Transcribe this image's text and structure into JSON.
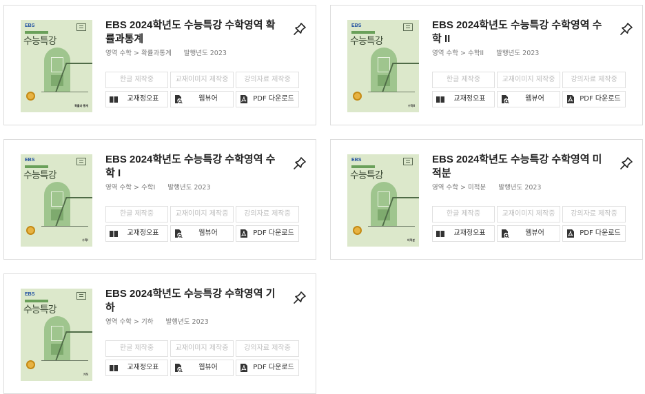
{
  "books": [
    {
      "title": "EBS 2024학년도 수능특강 수학영역 확률과통계",
      "field_label": "영역",
      "field_value": "수학 > 확률과통계",
      "year_label": "발행년도",
      "year_value": "2023",
      "cover": {
        "brand": "EBS",
        "title": "수능특강",
        "subject": "확률과 통계"
      },
      "buttons": {
        "hangul": "한글 제작중",
        "images": "교재이미지 제작중",
        "lecture": "강의자료 제작중",
        "errata": "교재정오표",
        "viewer": "웹뷰어",
        "pdf": "PDF 다운로드"
      }
    },
    {
      "title": "EBS 2024학년도 수능특강 수학영역 수학 II",
      "field_label": "영역",
      "field_value": "수학 > 수학II",
      "year_label": "발행년도",
      "year_value": "2023",
      "cover": {
        "brand": "EBS",
        "title": "수능특강",
        "subject": "수학Ⅱ"
      },
      "buttons": {
        "hangul": "한글 제작중",
        "images": "교재이미지 제작중",
        "lecture": "강의자료 제작중",
        "errata": "교재정오표",
        "viewer": "웹뷰어",
        "pdf": "PDF 다운로드"
      }
    },
    {
      "title": "EBS 2024학년도 수능특강 수학영역 수학 I",
      "field_label": "영역",
      "field_value": "수학 > 수학I",
      "year_label": "발행년도",
      "year_value": "2023",
      "cover": {
        "brand": "EBS",
        "title": "수능특강",
        "subject": "수학Ⅰ"
      },
      "buttons": {
        "hangul": "한글 제작중",
        "images": "교재이미지 제작중",
        "lecture": "강의자료 제작중",
        "errata": "교재정오표",
        "viewer": "웹뷰어",
        "pdf": "PDF 다운로드"
      }
    },
    {
      "title": "EBS 2024학년도 수능특강 수학영역 미적분",
      "field_label": "영역",
      "field_value": "수학 > 미적분",
      "year_label": "발행년도",
      "year_value": "2023",
      "cover": {
        "brand": "EBS",
        "title": "수능특강",
        "subject": "미적분"
      },
      "buttons": {
        "hangul": "한글 제작중",
        "images": "교재이미지 제작중",
        "lecture": "강의자료 제작중",
        "errata": "교재정오표",
        "viewer": "웹뷰어",
        "pdf": "PDF 다운로드"
      }
    },
    {
      "title": "EBS 2024학년도 수능특강 수학영역 기하",
      "field_label": "영역",
      "field_value": "수학 > 기하",
      "year_label": "발행년도",
      "year_value": "2023",
      "cover": {
        "brand": "EBS",
        "title": "수능특강",
        "subject": "기하"
      },
      "buttons": {
        "hangul": "한글 제작중",
        "images": "교재이미지 제작중",
        "lecture": "강의자료 제작중",
        "errata": "교재정오표",
        "viewer": "웹뷰어",
        "pdf": "PDF 다운로드"
      }
    }
  ],
  "colors": {
    "disabled_text": "#bdbdbd",
    "border": "#dcdcdc",
    "cover_bg": "#dce8cb"
  },
  "icons": {
    "pin": "pin-icon",
    "errata": "book-icon",
    "viewer": "document-search-icon",
    "pdf": "pdf-icon"
  }
}
